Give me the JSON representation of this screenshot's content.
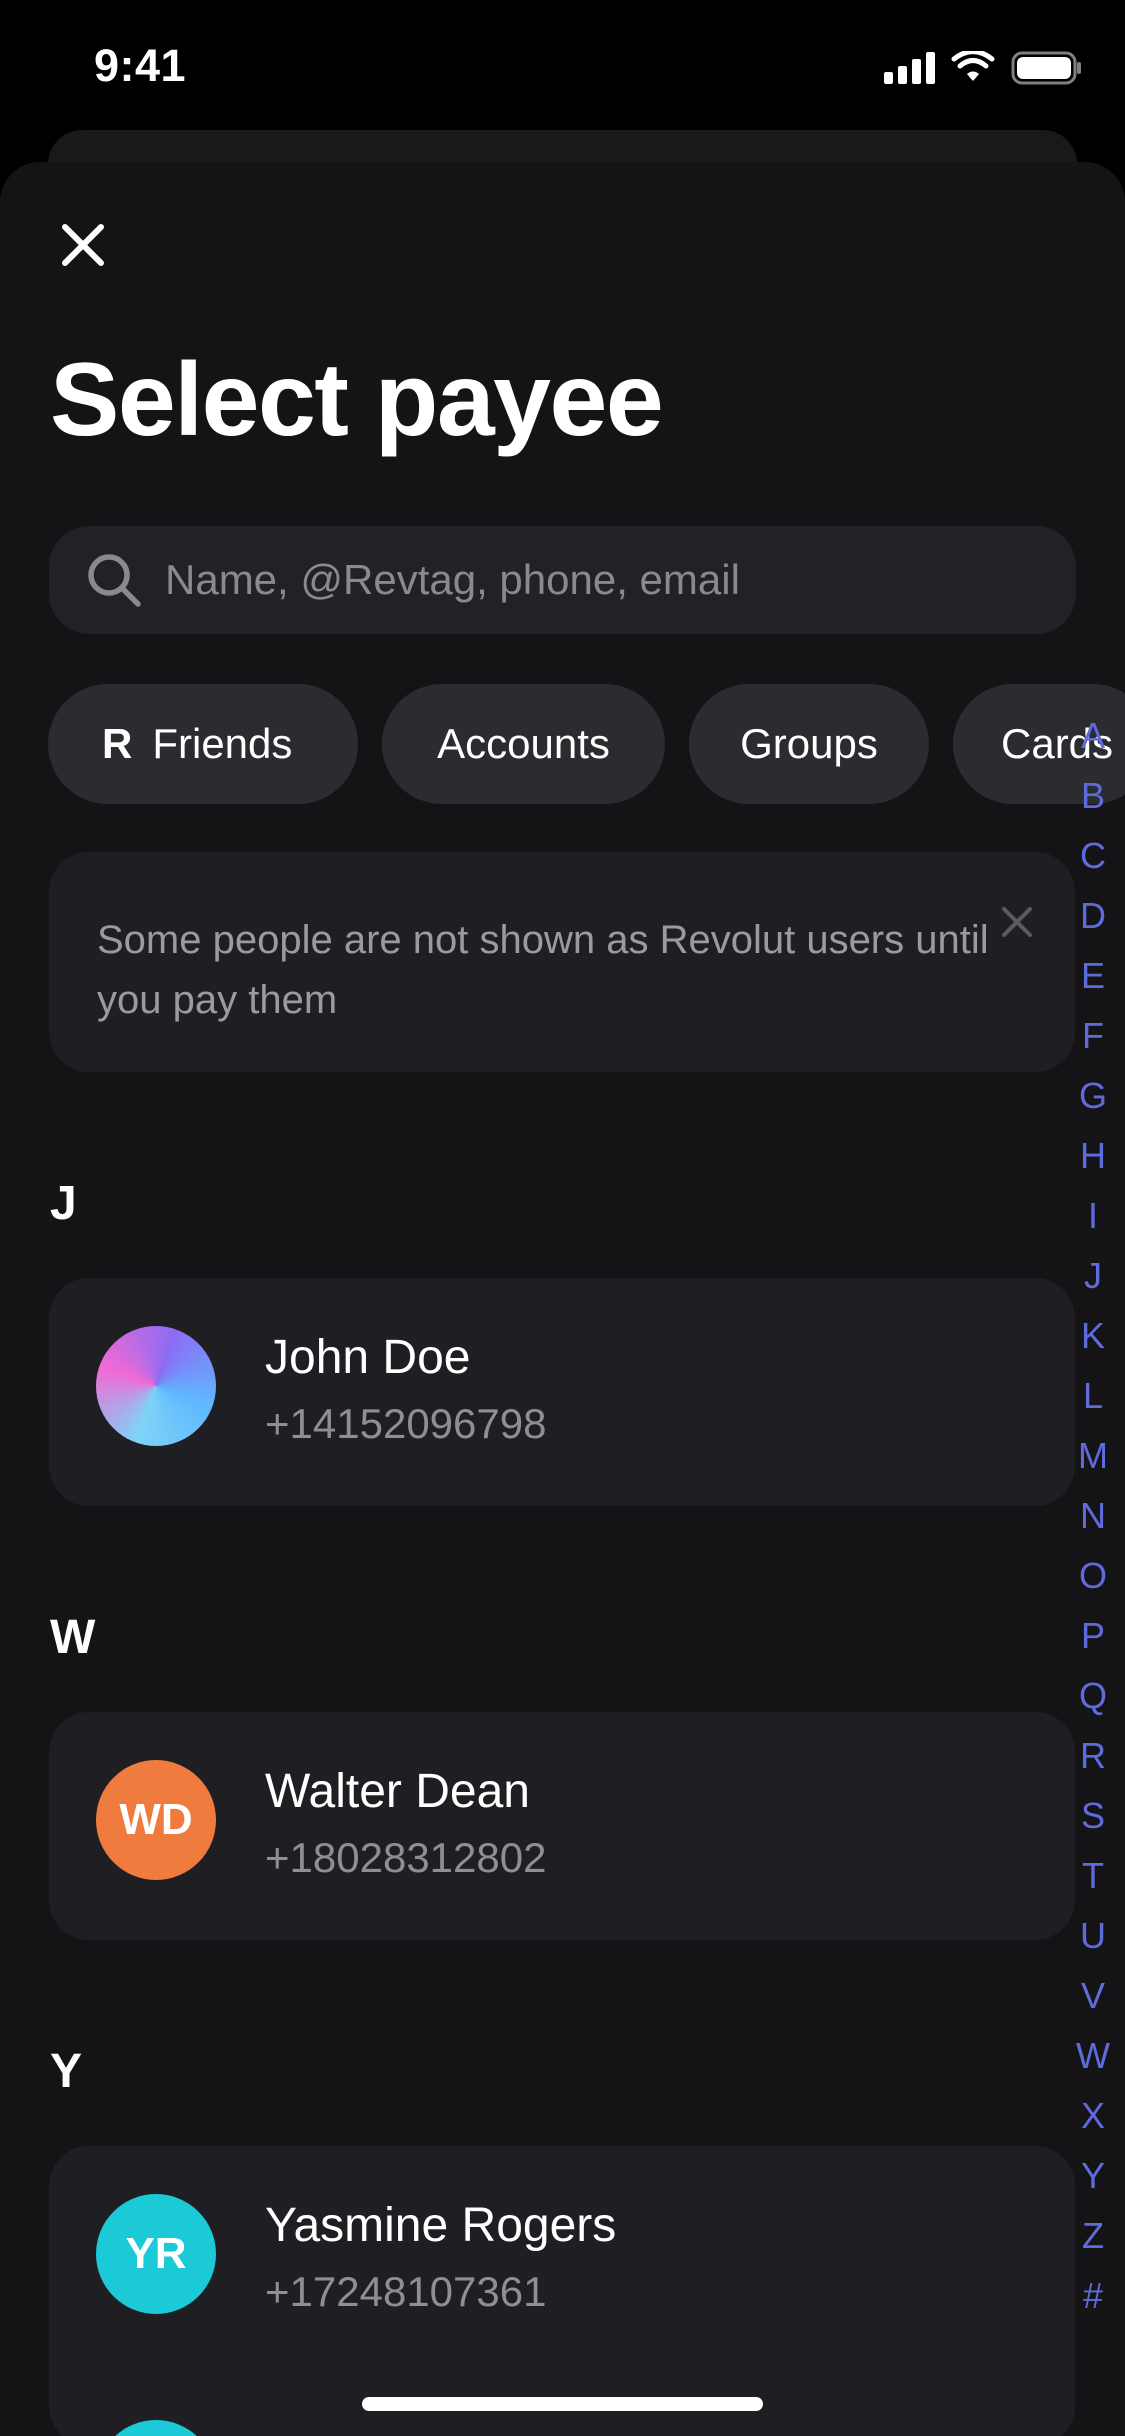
{
  "status_bar": {
    "time": "9:41"
  },
  "header": {
    "title": "Select payee"
  },
  "search": {
    "placeholder": "Name, @Revtag, phone, email",
    "value": ""
  },
  "filters": {
    "friends_logo": "R",
    "friends": "Friends",
    "accounts": "Accounts",
    "groups": "Groups",
    "cards": "Cards"
  },
  "notice": {
    "text": "Some people are not shown as Revolut users until you pay them"
  },
  "sections": [
    {
      "letter": "J",
      "contact": {
        "name": "John Doe",
        "phone": "+14152096798",
        "initials": ""
      }
    },
    {
      "letter": "W",
      "contact": {
        "name": "Walter Dean",
        "phone": "+18028312802",
        "initials": "WD",
        "color": "#f07b3f"
      }
    },
    {
      "letter": "Y",
      "contact": {
        "name": "Yasmine Rogers",
        "phone": "+17248107361",
        "initials": "YR",
        "color": "#1cc9d6"
      }
    }
  ],
  "alpha_index": [
    "A",
    "B",
    "C",
    "D",
    "E",
    "F",
    "G",
    "H",
    "I",
    "J",
    "K",
    "L",
    "M",
    "N",
    "O",
    "P",
    "Q",
    "R",
    "S",
    "T",
    "U",
    "V",
    "W",
    "X",
    "Y",
    "Z",
    "#"
  ],
  "icons": {
    "close": "close-icon",
    "search": "search-icon",
    "notice_close": "close-icon",
    "friends": "revolut-r-icon"
  },
  "colors": {
    "accent": "#5f6bdc",
    "background": "#141417",
    "card": "#1f1f23"
  }
}
